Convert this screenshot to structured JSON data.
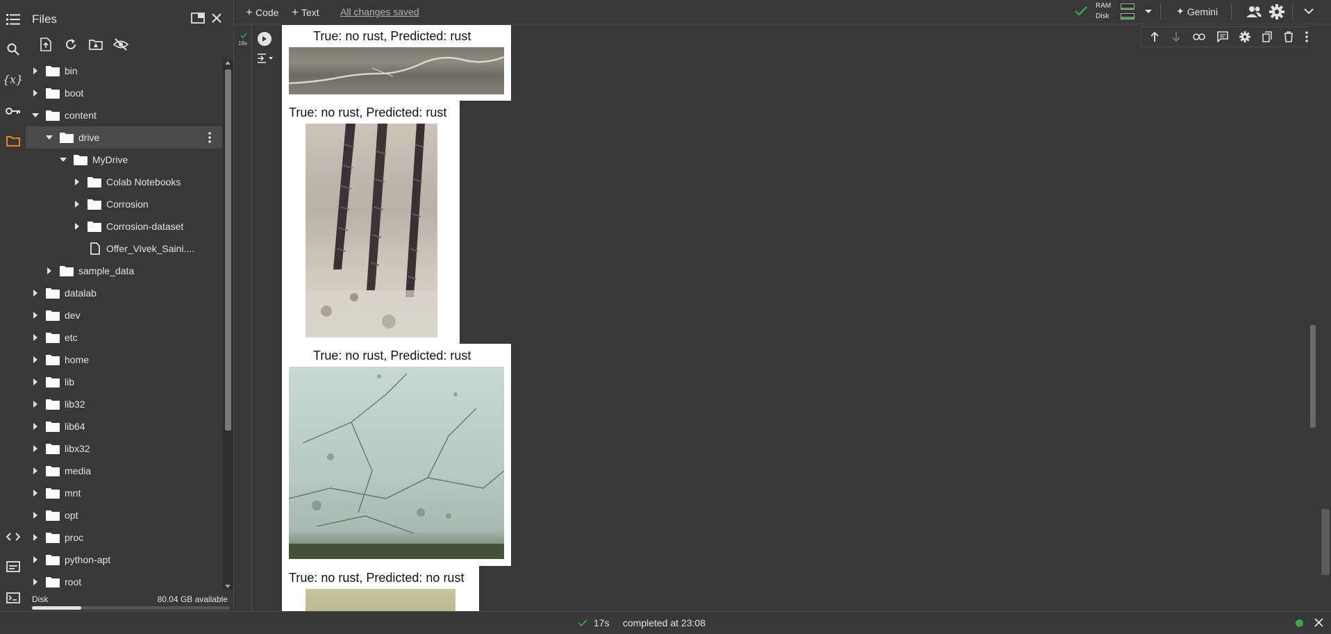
{
  "sidebar_panel": {
    "title": "Files",
    "tree": [
      {
        "label": "bin",
        "depth": 0,
        "type": "folder",
        "expanded": false
      },
      {
        "label": "boot",
        "depth": 0,
        "type": "folder",
        "expanded": false
      },
      {
        "label": "content",
        "depth": 0,
        "type": "folder",
        "expanded": true
      },
      {
        "label": "drive",
        "depth": 1,
        "type": "folder",
        "expanded": true,
        "selected": true
      },
      {
        "label": "MyDrive",
        "depth": 2,
        "type": "folder",
        "expanded": true
      },
      {
        "label": "Colab Notebooks",
        "depth": 3,
        "type": "folder",
        "expanded": false
      },
      {
        "label": "Corrosion",
        "depth": 3,
        "type": "folder",
        "expanded": false
      },
      {
        "label": "Corrosion-dataset",
        "depth": 3,
        "type": "folder",
        "expanded": false
      },
      {
        "label": "Offer_Vivek_Saini....",
        "depth": 3,
        "type": "file"
      },
      {
        "label": "sample_data",
        "depth": 1,
        "type": "folder",
        "expanded": false
      },
      {
        "label": "datalab",
        "depth": 0,
        "type": "folder",
        "expanded": false
      },
      {
        "label": "dev",
        "depth": 0,
        "type": "folder",
        "expanded": false
      },
      {
        "label": "etc",
        "depth": 0,
        "type": "folder",
        "expanded": false
      },
      {
        "label": "home",
        "depth": 0,
        "type": "folder",
        "expanded": false
      },
      {
        "label": "lib",
        "depth": 0,
        "type": "folder",
        "expanded": false
      },
      {
        "label": "lib32",
        "depth": 0,
        "type": "folder",
        "expanded": false
      },
      {
        "label": "lib64",
        "depth": 0,
        "type": "folder",
        "expanded": false
      },
      {
        "label": "libx32",
        "depth": 0,
        "type": "folder",
        "expanded": false
      },
      {
        "label": "media",
        "depth": 0,
        "type": "folder",
        "expanded": false
      },
      {
        "label": "mnt",
        "depth": 0,
        "type": "folder",
        "expanded": false
      },
      {
        "label": "opt",
        "depth": 0,
        "type": "folder",
        "expanded": false
      },
      {
        "label": "proc",
        "depth": 0,
        "type": "folder",
        "expanded": false
      },
      {
        "label": "python-apt",
        "depth": 0,
        "type": "folder",
        "expanded": false
      },
      {
        "label": "root",
        "depth": 0,
        "type": "folder",
        "expanded": false
      }
    ],
    "disk_label": "Disk",
    "disk_available": "80.04 GB available",
    "disk_used_fraction": 0.25
  },
  "toolbar": {
    "add_code_label": "Code",
    "add_text_label": "Text",
    "save_status": "All changes saved",
    "ram_label": "RAM",
    "disk_label": "Disk",
    "gemini_label": "Gemini"
  },
  "cell": {
    "exec_time_badge": "18s"
  },
  "output_figures": [
    {
      "title": "True: no rust, Predicted: rust",
      "image": "concrete-crack-photo"
    },
    {
      "title": "True: no rust, Predicted: rust",
      "image": "exposed-rebar-photo"
    },
    {
      "title": "True: no rust, Predicted: rust",
      "image": "painted-wall-cracks-photo"
    },
    {
      "title": "True: no rust, Predicted: no rust",
      "image": "beige-surface-photo"
    }
  ],
  "statusbar": {
    "duration": "17s",
    "completed_text": "completed at 23:08"
  },
  "colors": {
    "background": "#383838",
    "accent_orange": "#f29900",
    "success_green": "#34a853",
    "text": "#e3e3e3"
  }
}
